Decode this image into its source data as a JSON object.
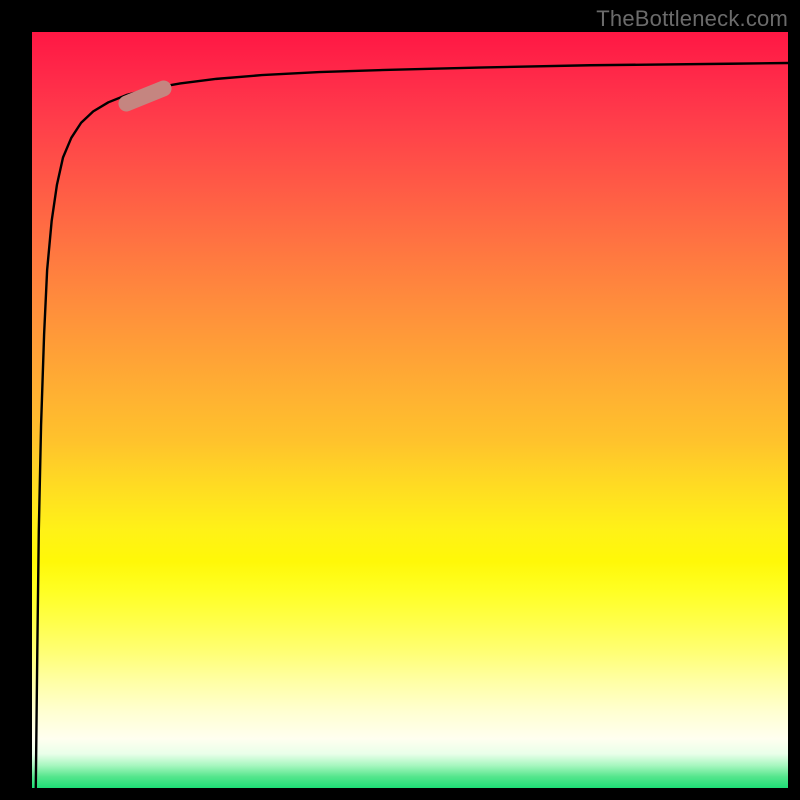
{
  "attribution": "TheBottleneck.com",
  "colors": {
    "curve_stroke": "#000000",
    "marker_fill": "#c58580",
    "background": "#000000"
  },
  "chart_data": {
    "type": "line",
    "title": "",
    "xlabel": "",
    "ylabel": "",
    "xlim": [
      0,
      100
    ],
    "ylim": [
      0,
      100
    ],
    "grid": false,
    "legend": false,
    "series": [
      {
        "name": "curve",
        "x": [
          0.5,
          0.7,
          0.9,
          1.2,
          1.6,
          2.0,
          2.6,
          3.3,
          4.1,
          5.2,
          6.5,
          8.1,
          10.1,
          12.6,
          15.7,
          19.6,
          24.4,
          30.4,
          38.0,
          47.4,
          59.1,
          73.8,
          92.1,
          100.0
        ],
        "y": [
          0.0,
          18.0,
          34.0,
          48.0,
          60.0,
          68.5,
          75.0,
          79.8,
          83.4,
          86.0,
          88.0,
          89.5,
          90.7,
          91.7,
          92.5,
          93.2,
          93.8,
          94.3,
          94.7,
          95.0,
          95.3,
          95.6,
          95.8,
          95.9
        ]
      }
    ],
    "marker": {
      "x": 15.0,
      "y": 91.6,
      "angle_deg": -22
    }
  }
}
